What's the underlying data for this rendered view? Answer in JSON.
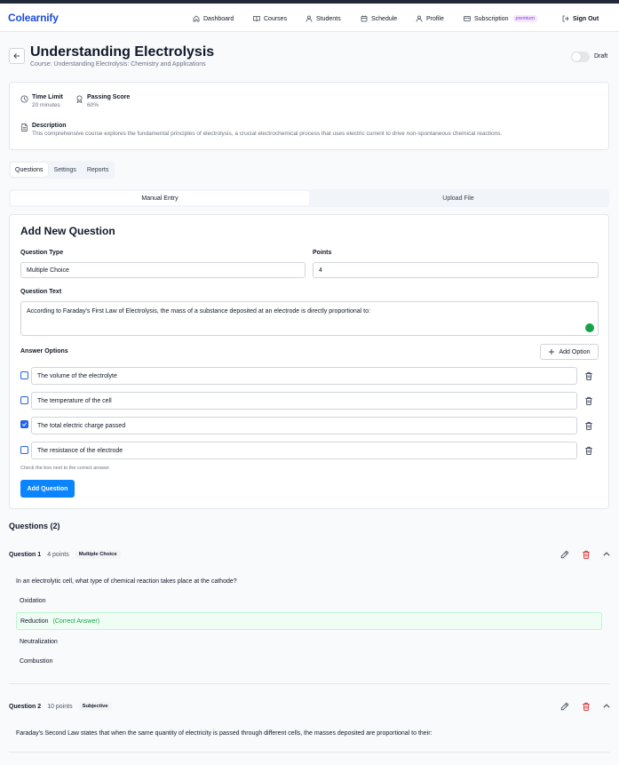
{
  "colors": {
    "brand": "#1d4ed8",
    "primary_button": "#0b84ff",
    "correct": "#16a34a",
    "delete": "#dc2626",
    "premium": "#9333ea"
  },
  "nav": {
    "logo": "Colearnify",
    "items": [
      {
        "label": "Dashboard",
        "icon": "home-icon"
      },
      {
        "label": "Courses",
        "icon": "book-icon"
      },
      {
        "label": "Students",
        "icon": "user-icon"
      },
      {
        "label": "Schedule",
        "icon": "calendar-icon"
      },
      {
        "label": "Profile",
        "icon": "user-icon"
      },
      {
        "label": "Subscription",
        "icon": "credit-card-icon",
        "badge": "premium"
      }
    ],
    "sign_out": "Sign Out"
  },
  "header": {
    "title": "Understanding Electrolysis",
    "subtitle": "Course: Understanding Electrolysis: Chemistry and Applications",
    "draft_label": "Draft",
    "draft_on": false
  },
  "info": {
    "time_limit_label": "Time Limit",
    "time_limit_value": "20 minutes",
    "passing_score_label": "Passing Score",
    "passing_score_value": "60%",
    "description_label": "Description",
    "description_value": "This comprehensive course explores the fundamental principles of electrolysis, a crucial electrochemical process that uses electric current to drive non-spontaneous chemical reactions."
  },
  "tabs": [
    "Questions",
    "Settings",
    "Reports"
  ],
  "active_tab": "Questions",
  "entry_tabs": [
    "Manual Entry",
    "Upload File"
  ],
  "form": {
    "title": "Add New Question",
    "question_type_label": "Question Type",
    "question_type_value": "Multiple Choice",
    "points_label": "Points",
    "points_value": "4",
    "question_text_label": "Question Text",
    "question_text_value": "According to Faraday's First Law of Electrolysis, the mass of a substance deposited at an electrode is directly proportional to:",
    "answer_options_label": "Answer Options",
    "add_option_label": "Add Option",
    "options": [
      {
        "text": "The volume of the electrolyte",
        "checked": false
      },
      {
        "text": "The temperature of the cell",
        "checked": false
      },
      {
        "text": "The total electric charge passed",
        "checked": true
      },
      {
        "text": "The resistance of the electrode",
        "checked": false
      }
    ],
    "hint": "Check the box next to the correct answer.",
    "submit_label": "Add Question"
  },
  "questions_heading": "Questions (2)",
  "questions": [
    {
      "label": "Question 1",
      "points": "4 points",
      "type": "Multiple Choice",
      "text": "In an electrolytic cell, what type of chemical reaction takes place at the cathode?",
      "options": [
        {
          "text": "Oxidation",
          "correct": false
        },
        {
          "text": "Reduction",
          "correct": true
        },
        {
          "text": "Neutralization",
          "correct": false
        },
        {
          "text": "Combustion",
          "correct": false
        }
      ],
      "correct_tag": "(Correct Answer)"
    },
    {
      "label": "Question 2",
      "points": "10 points",
      "type": "Subjective",
      "text": "Faraday's Second Law states that when the same quantity of electricity is passed through different cells, the masses deposited are proportional to their:"
    }
  ]
}
